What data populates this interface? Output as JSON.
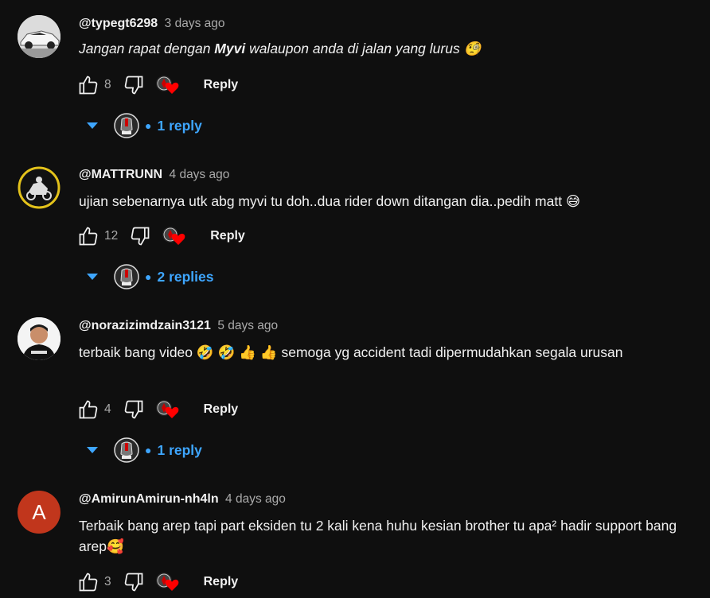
{
  "colors": {
    "background": "#0f0f0f",
    "link": "#3ea6ff",
    "heart": "#ff0000",
    "muted": "#aaaaaa",
    "avatar_a": "#c1361c"
  },
  "comments": [
    {
      "author": "@typegt6298",
      "time": "3 days ago",
      "text_parts": [
        "Jangan rapat dengan ",
        "Myvi",
        " walaupon anda di jalan yang lurus ",
        "🧐"
      ],
      "likes": "8",
      "reply_label": "Reply",
      "replies_label": "1 reply",
      "avatar_icon": "car-avatar"
    },
    {
      "author": "@MATTRUNN",
      "time": "4 days ago",
      "text": "ujian sebenarnya utk abg myvi tu doh..dua rider down ditangan dia..pedih matt 😅",
      "likes": "12",
      "reply_label": "Reply",
      "replies_label": "2 replies",
      "avatar_icon": "mattrunn-logo-avatar"
    },
    {
      "author": "@norazizimdzain3121",
      "time": "5 days ago",
      "text": "terbaik bang video 🤣 🤣 👍 👍  semoga yg accident tadi dipermudahkan segala urusan",
      "likes": "4",
      "reply_label": "Reply",
      "replies_label": "1 reply",
      "avatar_icon": "person-avatar"
    },
    {
      "author": "@AmirunAmirun-nh4ln",
      "time": "4 days ago",
      "text": "Terbaik bang arep tapi part eksiden tu 2 kali kena huhu kesian brother tu apa² hadir support bang arep🥰",
      "likes": "3",
      "reply_label": "Reply",
      "avatar_letter": "A"
    }
  ]
}
